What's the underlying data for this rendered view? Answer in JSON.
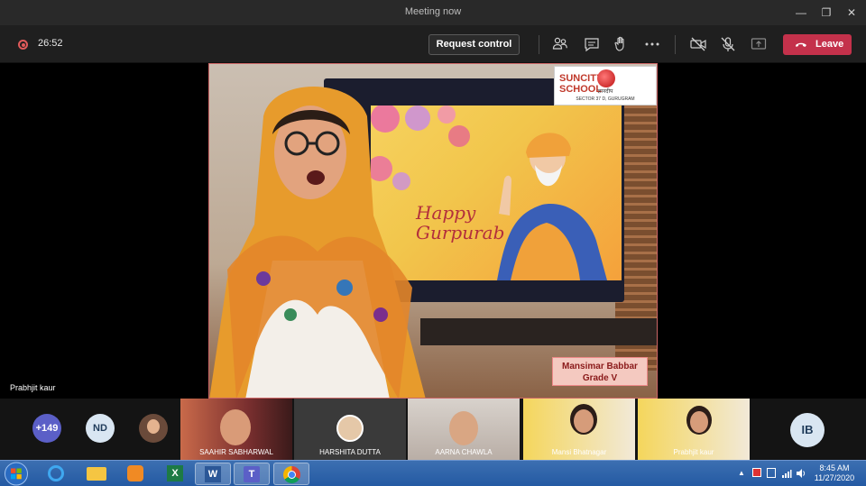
{
  "window": {
    "title": "Meeting now"
  },
  "toolbar": {
    "timer": "26:52",
    "request_control_label": "Request control",
    "leave_label": "Leave"
  },
  "stage": {
    "participant_name": "Prabhjit kaur",
    "school_logo_line1": "SUNCITY",
    "school_logo_line2": "SCHOOL",
    "school_logo_motto": "ज्ञानदीप",
    "school_logo_location": "SECTOR 37 D, GURUGRAM",
    "name_card_line1": "Mansimar Babbar",
    "name_card_line2": "Grade V",
    "tv_text_line1": "Happy",
    "tv_text_line2": "Gurpurab"
  },
  "gallery": {
    "overflow_count": "+149",
    "avatars": [
      "ND",
      "IB"
    ],
    "tiles": [
      {
        "name": "SAAHIR SABHARWAL"
      },
      {
        "name": "HARSHITA DUTTA"
      },
      {
        "name": "AARNA CHAWLA"
      },
      {
        "name": "Mansi Bhatnagar"
      },
      {
        "name": "Prabhjit kaur"
      }
    ]
  },
  "taskbar": {
    "time": "8:45 AM",
    "date": "11/27/2020"
  },
  "colors": {
    "leave": "#c4314b",
    "titlebar": "#292929",
    "toolbar": "#1f1f1f",
    "taskbar": "#245aa3"
  }
}
